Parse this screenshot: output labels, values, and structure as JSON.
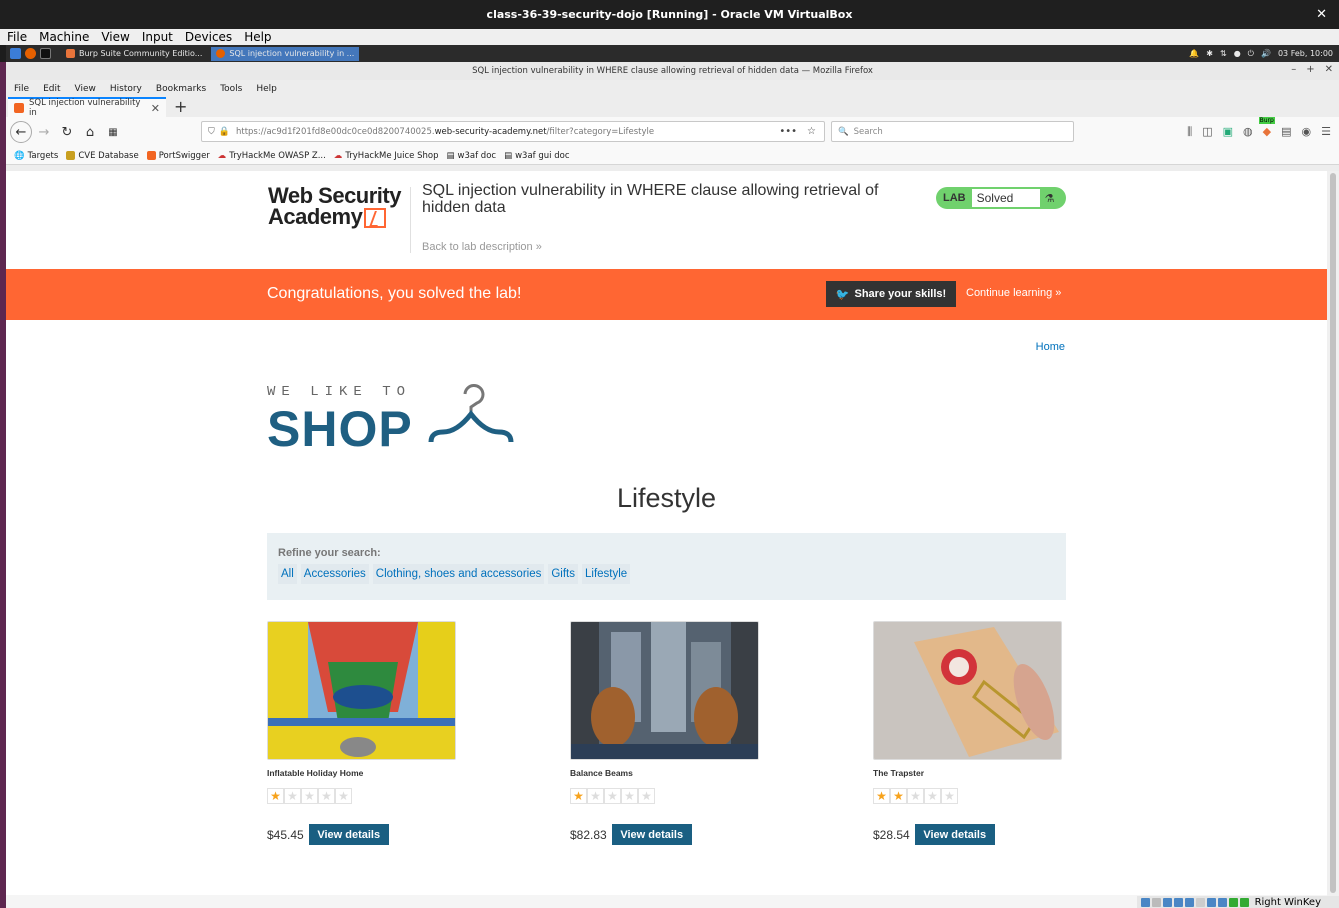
{
  "vbox": {
    "title": "class-36-39-security-dojo [Running] - Oracle VM VirtualBox",
    "menu": [
      "File",
      "Machine",
      "View",
      "Input",
      "Devices",
      "Help"
    ],
    "status_key": "Right WinKey"
  },
  "guest_panel": {
    "tasks": [
      "Burp Suite Community Editio...",
      "SQL injection vulnerability in ..."
    ],
    "clock": "03 Feb, 10:00"
  },
  "firefox": {
    "window_title": "SQL injection vulnerability in WHERE clause allowing retrieval of hidden data — Mozilla Firefox",
    "menu": [
      "File",
      "Edit",
      "View",
      "History",
      "Bookmarks",
      "Tools",
      "Help"
    ],
    "tab_label": "SQL injection vulnerability in",
    "url_prefix": "https://ac9d1f201fd8e00dc0ce0d8200740025.",
    "url_host": "web-security-academy.net",
    "url_path": "/filter?category=Lifestyle",
    "search_placeholder": "Search",
    "bookmarks": [
      "Targets",
      "CVE Database",
      "PortSwigger",
      "TryHackMe OWASP Z...",
      "TryHackMe Juice Shop",
      "w3af doc",
      "w3af gui doc"
    ],
    "burp_badge": "Burp"
  },
  "lab": {
    "logo_line1": "Web Security",
    "logo_line2": "Academy",
    "title": "SQL injection vulnerability in WHERE clause allowing retrieval of hidden data",
    "back_link": "Back to lab description",
    "status_tag": "LAB",
    "status_value": "Solved",
    "banner_message": "Congratulations, you solved the lab!",
    "share_button": "Share your skills!",
    "continue_link": "Continue learning"
  },
  "shop": {
    "home_link": "Home",
    "tagline": "WE LIKE TO",
    "brand": "SHOP",
    "category_title": "Lifestyle",
    "refine_label": "Refine your search:",
    "filters": [
      "All",
      "Accessories",
      "Clothing, shoes and accessories",
      "Gifts",
      "Lifestyle"
    ],
    "products": [
      {
        "name": "Inflatable Holiday Home",
        "price": "$45.45",
        "rating": 1,
        "button": "View details"
      },
      {
        "name": "Balance Beams",
        "price": "$82.83",
        "rating": 1,
        "button": "View details"
      },
      {
        "name": "The Trapster",
        "price": "$28.54",
        "rating": 2,
        "button": "View details"
      }
    ]
  },
  "colors": {
    "banner": "#ff6633",
    "shop_blue": "#1f5f82",
    "link_blue": "#0071bc",
    "lab_green": "#70d16d"
  }
}
